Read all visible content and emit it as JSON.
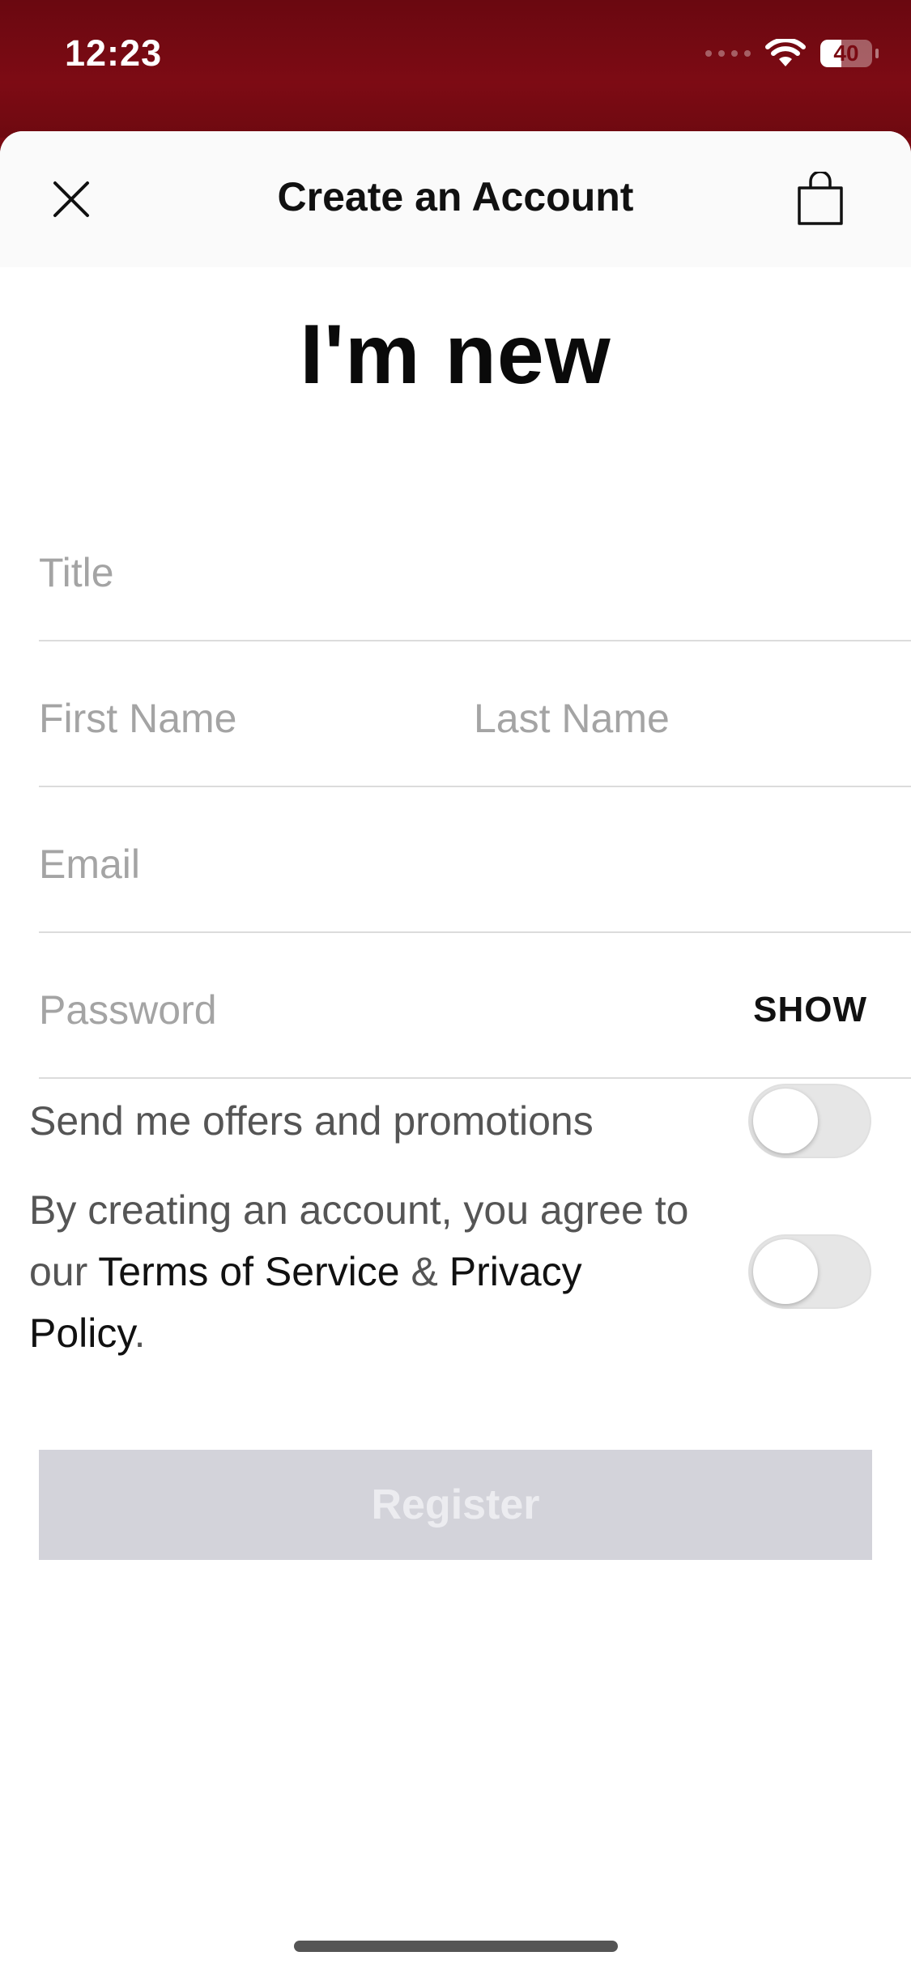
{
  "status_bar": {
    "time": "12:23",
    "battery": "40",
    "battery_level": 0.4
  },
  "nav": {
    "title": "Create an Account",
    "close_icon": "close-icon",
    "bag_icon": "shopping-bag-icon"
  },
  "heading": "I'm new",
  "form": {
    "title_placeholder": "Title",
    "first_name_placeholder": "First Name",
    "last_name_placeholder": "Last Name",
    "email_placeholder": "Email",
    "password_placeholder": "Password",
    "show_label": "SHOW"
  },
  "offers": {
    "label": "Send me offers and promotions",
    "enabled": false
  },
  "terms": {
    "text_1": "By creating an account, you agree to our ",
    "terms_link": "Terms of Service",
    "text_2": " & ",
    "privacy_link": "Privacy Policy",
    "text_3": ".",
    "enabled": false
  },
  "register_label": "Register",
  "colors": {
    "brand": "#7a0a12",
    "button_disabled": "#d3d3da",
    "placeholder": "#a4a4a4"
  }
}
